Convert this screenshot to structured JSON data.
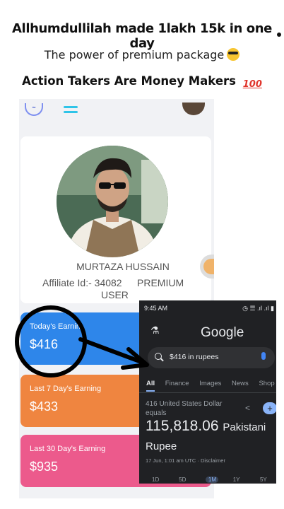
{
  "headlines": {
    "line1": "Allhumdullilah made 1lakh 15k  in one day",
    "line2": "The power of premium package",
    "line3": "Action Takers Are Money Makers"
  },
  "profile": {
    "name": "MURTAZA HUSSAIN",
    "affiliate_id": "Affiliate Id:- 34082",
    "plan_line1": "PREMIUM",
    "plan_line2": "USER"
  },
  "earnings": [
    {
      "label": "Today's Earnin",
      "value": "$416"
    },
    {
      "label": "Last 7 Day's Earning",
      "value": "$433"
    },
    {
      "label": "Last 30 Day's Earning",
      "value": "$935"
    }
  ],
  "google": {
    "status_time": "9:45 AM",
    "logo": "Google",
    "query": "$416 in rupees",
    "tabs": [
      "All",
      "Finance",
      "Images",
      "News",
      "Shop"
    ],
    "from_line": "416 United States Dollar equals",
    "result_value": "115,818.06",
    "result_unit_1": "Pakistani",
    "result_unit_2": "Rupee",
    "timestamp": "17 Jun, 1:01 am UTC · Disclaimer",
    "ranges": [
      "1D",
      "5D",
      "1M",
      "1Y",
      "5Y"
    ]
  },
  "colors": {
    "today_card": "#2e86ea",
    "week_card": "#ef8540",
    "month_card": "#ec5a8c",
    "google_bg": "#202124"
  },
  "icons": [
    "cool-emoji-icon",
    "hundred-emoji-icon",
    "hamburger-menu-icon",
    "lab-flask-icon",
    "search-icon",
    "mic-icon",
    "share-icon",
    "plus-icon"
  ]
}
